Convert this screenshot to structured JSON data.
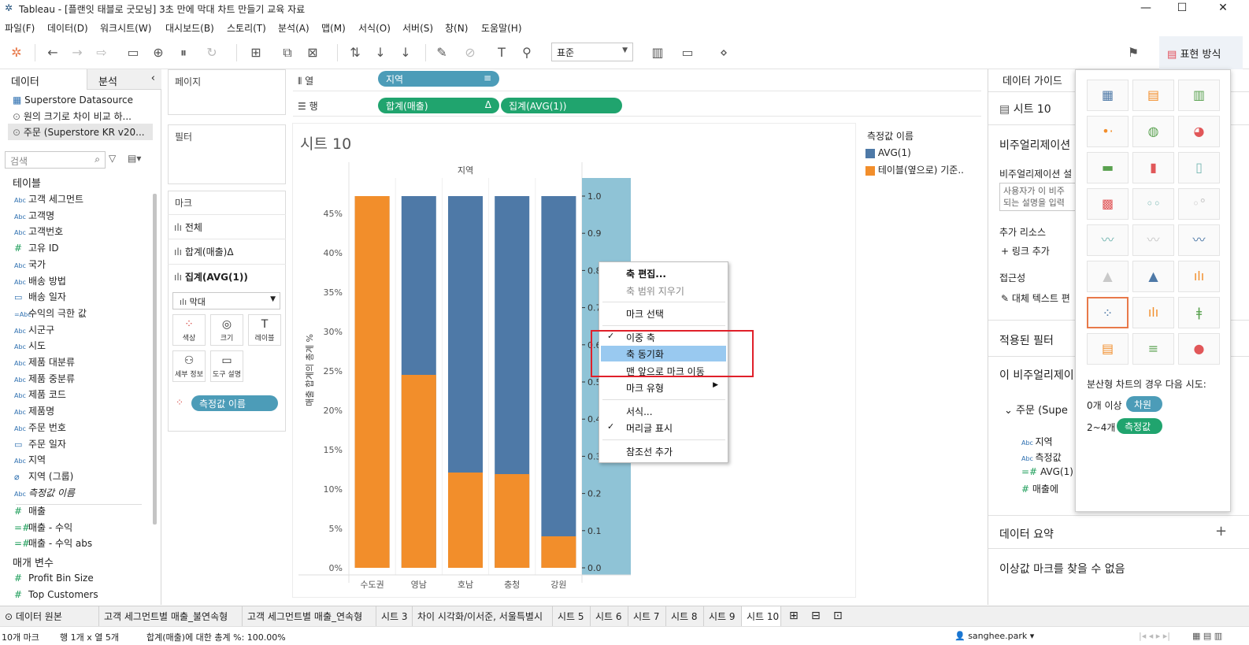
{
  "window": {
    "title": "Tableau - [플랜잇 태블로 굿모닝] 3초 만에 막대 차트 만들기 교육 자료"
  },
  "menu": [
    "파일(F)",
    "데이터(D)",
    "워크시트(W)",
    "대시보드(B)",
    "스토리(T)",
    "분석(A)",
    "맵(M)",
    "서식(O)",
    "서버(S)",
    "창(N)",
    "도움말(H)"
  ],
  "toolbar": {
    "fit_select": "표준",
    "format_button": "표현 방식"
  },
  "left": {
    "tab_data": "데이터",
    "tab_analysis": "분석",
    "datasources": [
      "Superstore Datasource",
      "원의 크기로 차이 비교 하...",
      "주문 (Superstore KR v20..."
    ],
    "search_placeholder": "검색",
    "tables_header": "테이블",
    "fields": [
      {
        "type": "Abc",
        "name": "고객 세그먼트"
      },
      {
        "type": "Abc",
        "name": "고객명"
      },
      {
        "type": "Abc",
        "name": "고객번호"
      },
      {
        "type": "#",
        "name": "고유 ID"
      },
      {
        "type": "Abc",
        "name": "국가"
      },
      {
        "type": "Abc",
        "name": "배송 방법"
      },
      {
        "type": "cal",
        "name": "배송 일자"
      },
      {
        "type": "=Abc",
        "name": "수익의 극한 값"
      },
      {
        "type": "Abc",
        "name": "시군구"
      },
      {
        "type": "Abc",
        "name": "시도"
      },
      {
        "type": "Abc",
        "name": "제품 대분류"
      },
      {
        "type": "Abc",
        "name": "제품 중분류"
      },
      {
        "type": "Abc",
        "name": "제품 코드"
      },
      {
        "type": "Abc",
        "name": "제품명"
      },
      {
        "type": "Abc",
        "name": "주문 번호"
      },
      {
        "type": "cal",
        "name": "주문 일자"
      },
      {
        "type": "Abc",
        "name": "지역"
      },
      {
        "type": "clip",
        "name": "지역 (그룹)"
      },
      {
        "type": "Abc",
        "name": "측정값 이름"
      }
    ],
    "measures": [
      {
        "type": "#",
        "name": "매출"
      },
      {
        "type": "=#",
        "name": "매출 - 수익"
      },
      {
        "type": "=#",
        "name": "매출 - 수익 abs"
      }
    ],
    "params_header": "매개 변수",
    "params": [
      "Profit Bin Size",
      "Top Customers"
    ]
  },
  "shelves": {
    "pages": "페이지",
    "filters": "필터",
    "marks": "마크",
    "marks_all": "전체",
    "marks_sum": "합계(매출)Δ",
    "marks_avg": "집계(AVG(1))",
    "mark_type": "막대",
    "btn_color": "색상",
    "btn_size": "크기",
    "btn_label": "레이블",
    "btn_detail": "세부 정보",
    "btn_tooltip": "도구 설명",
    "mark_pill": "측정값 이름",
    "columns_label": "열",
    "rows_label": "행",
    "col_pill": "지역",
    "row_pill1": "합계(매출)",
    "row_pill1_delta": "Δ",
    "row_pill2": "집계(AVG(1))"
  },
  "sheet": {
    "title": "시트 10",
    "header": "지역",
    "yaxis_title": "매출 합계의 총계 %"
  },
  "legend": {
    "title": "측정값 이름",
    "items": [
      {
        "name": "AVG(1)",
        "color": "#4e79a7"
      },
      {
        "name": "테이블(옆으로) 기준..",
        "color": "#f28e2b"
      }
    ]
  },
  "chart_data": {
    "type": "bar",
    "categories": [
      "수도권",
      "영남",
      "호남",
      "충청",
      "강원"
    ],
    "series": [
      {
        "name": "AVG(1)",
        "color": "#4e79a7",
        "values": [
          1.0,
          1.0,
          1.0,
          1.0,
          1.0
        ]
      },
      {
        "name": "테이블(옆으로) 기준..",
        "color": "#f28e2b",
        "values": [
          47.2,
          24.5,
          12.1,
          11.9,
          4.0
        ]
      }
    ],
    "yaxis_left": {
      "ticks": [
        "0%",
        "5%",
        "10%",
        "15%",
        "20%",
        "25%",
        "30%",
        "35%",
        "40%",
        "45%"
      ],
      "ylim": [
        0,
        47.2
      ]
    },
    "yaxis_right": {
      "ticks": [
        "0.0",
        "0.1",
        "0.2",
        "0.3",
        "0.4",
        "0.5",
        "0.6",
        "0.7",
        "0.8",
        "0.9",
        "1.0"
      ],
      "ylim": [
        0,
        1.0
      ]
    },
    "xlabel": "지역",
    "ylabel": "매출 합계의 총계 %"
  },
  "context_menu": {
    "items": [
      {
        "label": "축 편집...",
        "bold": true
      },
      {
        "label": "축 범위 지우기",
        "disabled": true
      },
      {
        "sep": true
      },
      {
        "label": "마크 선택"
      },
      {
        "sep": true
      },
      {
        "label": "이중 축",
        "checked": true
      },
      {
        "label": "축 동기화",
        "highlight": true
      },
      {
        "label": "맨 앞으로 마크 이동"
      },
      {
        "label": "마크 유형",
        "submenu": true
      },
      {
        "sep": true
      },
      {
        "label": "서식..."
      },
      {
        "label": "머리글 표시",
        "checked": true
      },
      {
        "sep": true
      },
      {
        "label": "참조선 추가"
      }
    ]
  },
  "guide": {
    "header": "데이터 가이드",
    "sheet": "시트 10",
    "vis_title": "비주얼리제이션",
    "vis_desc_label": "비주얼리제이션 설",
    "vis_desc_placeholder1": "사용자가 이 비주",
    "vis_desc_placeholder2": "되는 설명을 입력",
    "resources": "추가 리소스",
    "add_link": "링크 추가",
    "access": "접근성",
    "alt_text": "대체 텍스트 편",
    "applied_filters": "적용된 필터",
    "this_vis": "이 비주얼리제이",
    "order_ds": "주문 (Supe",
    "fields": [
      "지역",
      "측정값",
      "AVG(1)",
      "매출에"
    ],
    "data_summary": "데이터 요약",
    "outlier": "이상값 마크를 찾을 수 없음"
  },
  "showme": {
    "hint": "분산형 차트의 경우 다음 시도:",
    "dim_text": "0개 이상",
    "dim_pill": "차원",
    "meas_text": "2~4개",
    "meas_pill": "측정값"
  },
  "sheet_tabs": [
    "데이터 원본",
    "고객 세그먼트별 매출_불연속형",
    "고객 세그먼트별 매출_연속형",
    "시트 3",
    "차이 시각화/이서준, 서울특별시",
    "시트 5",
    "시트 6",
    "시트 7",
    "시트 8",
    "시트 9",
    "시트 10"
  ],
  "status": {
    "marks": "10개 마크",
    "rows_cols": "행 1개 x 열 5개",
    "sum": "합계(매출)에 대한 총계 %: 100.00%",
    "user": "sanghee.park"
  }
}
